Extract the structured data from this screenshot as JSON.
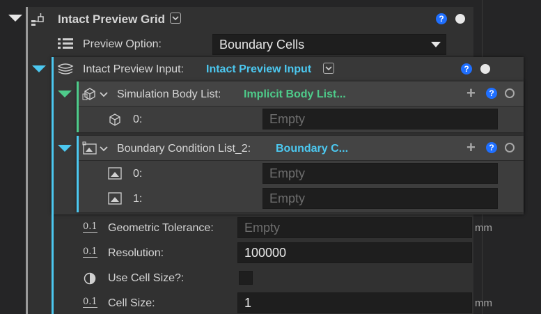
{
  "grid": {
    "title": "Intact Preview Grid",
    "preview_option_label": "Preview Option:",
    "preview_option_value": "Boundary Cells",
    "input_label": "Intact Preview Input:",
    "input_value": "Intact Preview Input"
  },
  "simulation": {
    "label": "Simulation Body List:",
    "value": "Implicit Body List...",
    "items": [
      {
        "index": "0:",
        "value": "Empty"
      }
    ]
  },
  "boundary": {
    "label": "Boundary Condition List_2:",
    "value": "Boundary C...",
    "items": [
      {
        "index": "0:",
        "value": "Empty"
      },
      {
        "index": "1:",
        "value": "Empty"
      }
    ]
  },
  "params": {
    "num_icon": "0.1",
    "geometric_tolerance_label": "Geometric Tolerance:",
    "geometric_tolerance_value": "Empty",
    "geometric_tolerance_unit": "mm",
    "resolution_label": "Resolution:",
    "resolution_value": "100000",
    "use_cell_size_label": "Use Cell Size?:",
    "use_cell_size_checked": false,
    "cell_size_label": "Cell Size:",
    "cell_size_value": "1",
    "cell_size_unit": "mm"
  },
  "help_glyph": "?",
  "plus_glyph": "+",
  "colors": {
    "accent_cyan": "#4cc8f0",
    "accent_green": "#4ecb8a",
    "help_blue": "#1f6fff"
  }
}
